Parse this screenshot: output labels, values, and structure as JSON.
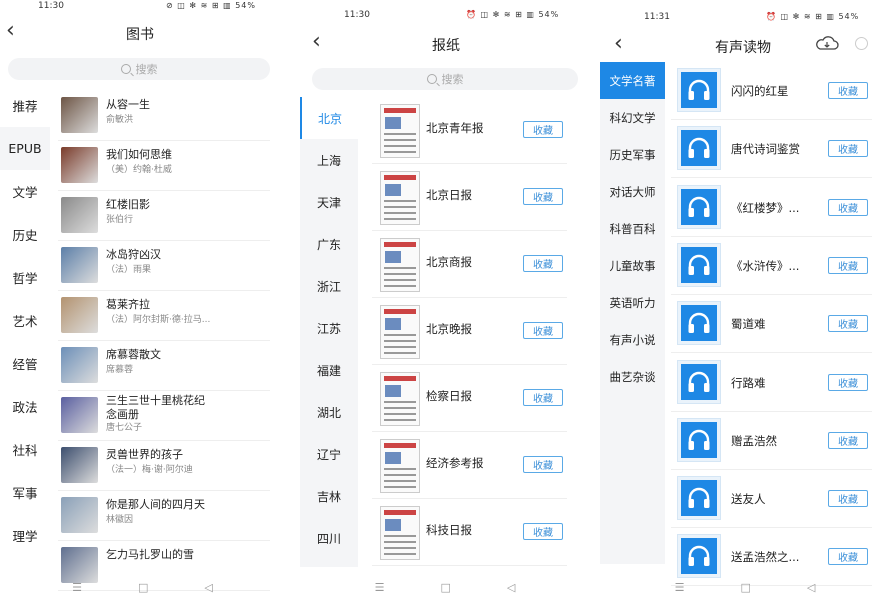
{
  "screen1": {
    "status_time": "11:30",
    "status_icons": "⊘ ◫ ✻ ≋ ⊞ ▥ 54%",
    "title": "图书",
    "search_placeholder": "搜索",
    "categories": [
      "推荐",
      "EPUB",
      "文学",
      "历史",
      "哲学",
      "艺术",
      "经管",
      "政法",
      "社科",
      "军事",
      "理学"
    ],
    "books": [
      {
        "title": "从容一生",
        "author": "俞敏洪"
      },
      {
        "title": "我们如何思维",
        "author": "（美）约翰·杜威"
      },
      {
        "title": "红楼旧影",
        "author": "张伯行"
      },
      {
        "title": "冰岛狩凶汉",
        "author": "（法）雨果"
      },
      {
        "title": "葛莱齐拉",
        "author": "（法）阿尔封斯·德·拉马..."
      },
      {
        "title": "席慕蓉散文",
        "author": "席慕蓉"
      },
      {
        "title": "三生三世十里桃花纪",
        "title2": "念画册",
        "author": "唐七公子"
      },
      {
        "title": "灵兽世界的孩子",
        "author": "（法一）梅·谢·阿尔迪"
      },
      {
        "title": "你是那人间的四月天",
        "author": "林徽因"
      },
      {
        "title": "乞力马扎罗山的雪",
        "author": ""
      }
    ]
  },
  "screen2": {
    "status_time": "11:30",
    "status_icons": "⏰ ◫ ✻ ≋ ⊞ ▥ 54%",
    "title": "报纸",
    "search_placeholder": "搜索",
    "categories": [
      "北京",
      "上海",
      "天津",
      "广东",
      "浙江",
      "江苏",
      "福建",
      "湖北",
      "辽宁",
      "吉林",
      "四川"
    ],
    "papers": [
      "北京青年报",
      "北京日报",
      "北京商报",
      "北京晚报",
      "检察日报",
      "经济参考报",
      "科技日报"
    ],
    "fav_label": "收藏"
  },
  "screen3": {
    "status_time": "11:31",
    "status_icons": "⏰ ◫ ✻ ≋ ⊞ ▥ 54%",
    "title": "有声读物",
    "categories": [
      "文学名著",
      "科幻文学",
      "历史军事",
      "对话大师",
      "科普百科",
      "儿童故事",
      "英语听力",
      "有声小说",
      "曲艺杂谈"
    ],
    "audios": [
      "闪闪的红星",
      "唐代诗词鉴赏",
      "《红楼梦》...",
      "《水浒传》...",
      "蜀道难",
      "行路难",
      "赠孟浩然",
      "送友人",
      "送孟浩然之..."
    ],
    "fav_label": "收藏"
  },
  "navbar": {
    "menu": "☰",
    "home": "□",
    "back": "◁"
  },
  "colors": {
    "accent": "#1e88e5",
    "sidebar_bg": "#f4f5f7"
  }
}
